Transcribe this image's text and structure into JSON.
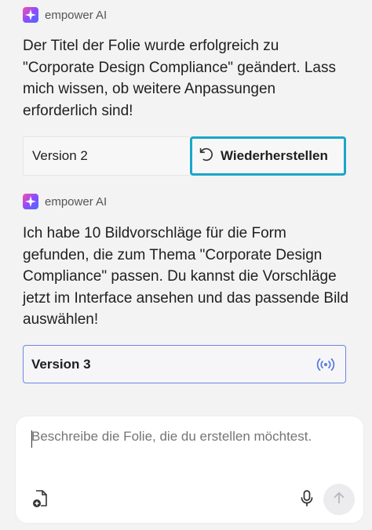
{
  "messages": [
    {
      "sender": "empower AI",
      "text": "Der Titel der Folie wurde erfolgreich zu \"Corporate Design Compliance\" geändert. Lass mich wissen, ob weitere Anpassungen erforderlich sind!",
      "version_label": "Version 2",
      "restore_label": "Wiederherstellen"
    },
    {
      "sender": "empower AI",
      "text": "Ich habe 10 Bildvorschläge für die Form gefunden, die zum Thema \"Corporate Design Compliance\" passen. Du kannst die Vorschläge jetzt im Interface ansehen und das passende Bild auswählen!",
      "version_label": "Version 3"
    }
  ],
  "composer": {
    "placeholder": "Beschreibe die Folie, die du erstellen möchtest.",
    "value": ""
  },
  "icons": {
    "logo": "empower-logo-icon",
    "restore": "undo-icon",
    "live": "broadcast-icon",
    "attach": "file-add-icon",
    "mic": "microphone-icon",
    "send": "arrow-up-icon"
  },
  "colors": {
    "accent_cyan": "#1aa6c8",
    "accent_blue": "#6d87e0",
    "background": "#f3f3f4"
  }
}
